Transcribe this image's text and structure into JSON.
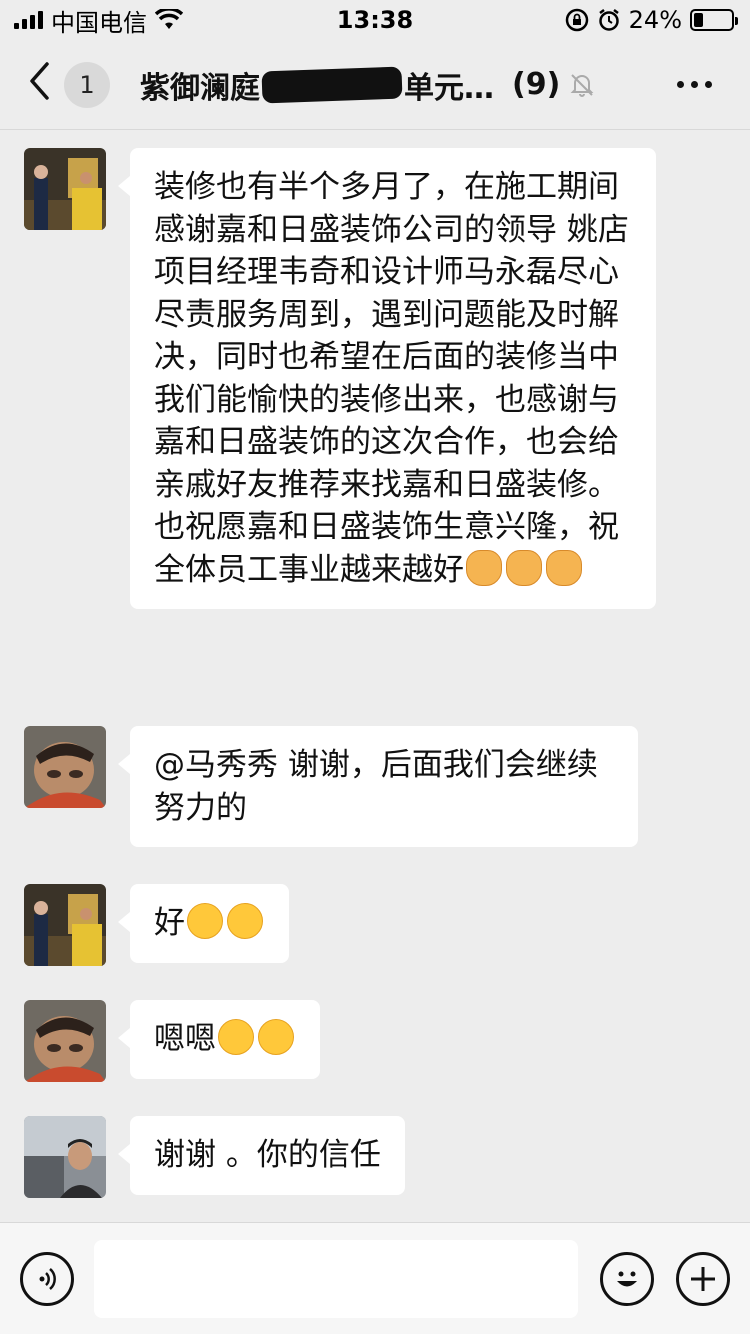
{
  "status_bar": {
    "carrier": "中国电信",
    "time": "13:38",
    "battery_percent": "24%",
    "battery_level": 0.24,
    "signal_bars": 4
  },
  "nav": {
    "unread_count": "1",
    "title_prefix": "紫御澜庭",
    "title_suffix": "单元…",
    "member_count": "(9)",
    "icons": [
      "back-chevron-icon",
      "mute-bell-icon",
      "more-dots-icon"
    ]
  },
  "messages": [
    {
      "sender_avatar": "avatar-a",
      "text": "装修也有半个多月了，在施工期间感谢嘉和日盛装饰公司的领导 姚店 项目经理韦奇和设计师马永磊尽心尽责服务周到，遇到问题能及时解决，同时也希望在后面的装修当中我们能愉快的装修出来，也感谢与嘉和日盛装饰的这次合作，也会给亲戚好友推荐来找嘉和日盛装修。也祝愿嘉和日盛装饰生意兴隆，祝全体员工事业越来越好",
      "emoji": [
        "fist-emoji",
        "fist-emoji",
        "fist-emoji"
      ]
    },
    {
      "sender_avatar": "avatar-b",
      "text": "@马秀秀 谢谢，后面我们会继续努力的",
      "emoji": []
    },
    {
      "sender_avatar": "avatar-a",
      "text": "好",
      "emoji": [
        "smile-emoji",
        "smile-emoji"
      ]
    },
    {
      "sender_avatar": "avatar-b",
      "text": "嗯嗯",
      "emoji": [
        "smile-emoji",
        "smile-emoji"
      ]
    },
    {
      "sender_avatar": "avatar-c",
      "text": "谢谢 。你的信任",
      "emoji": []
    }
  ],
  "input_bar": {
    "icons": [
      "voice-icon",
      "emoji-icon",
      "plus-icon"
    ]
  },
  "colors": {
    "background": "#ededed",
    "bubble": "#ffffff",
    "text": "#111111"
  }
}
